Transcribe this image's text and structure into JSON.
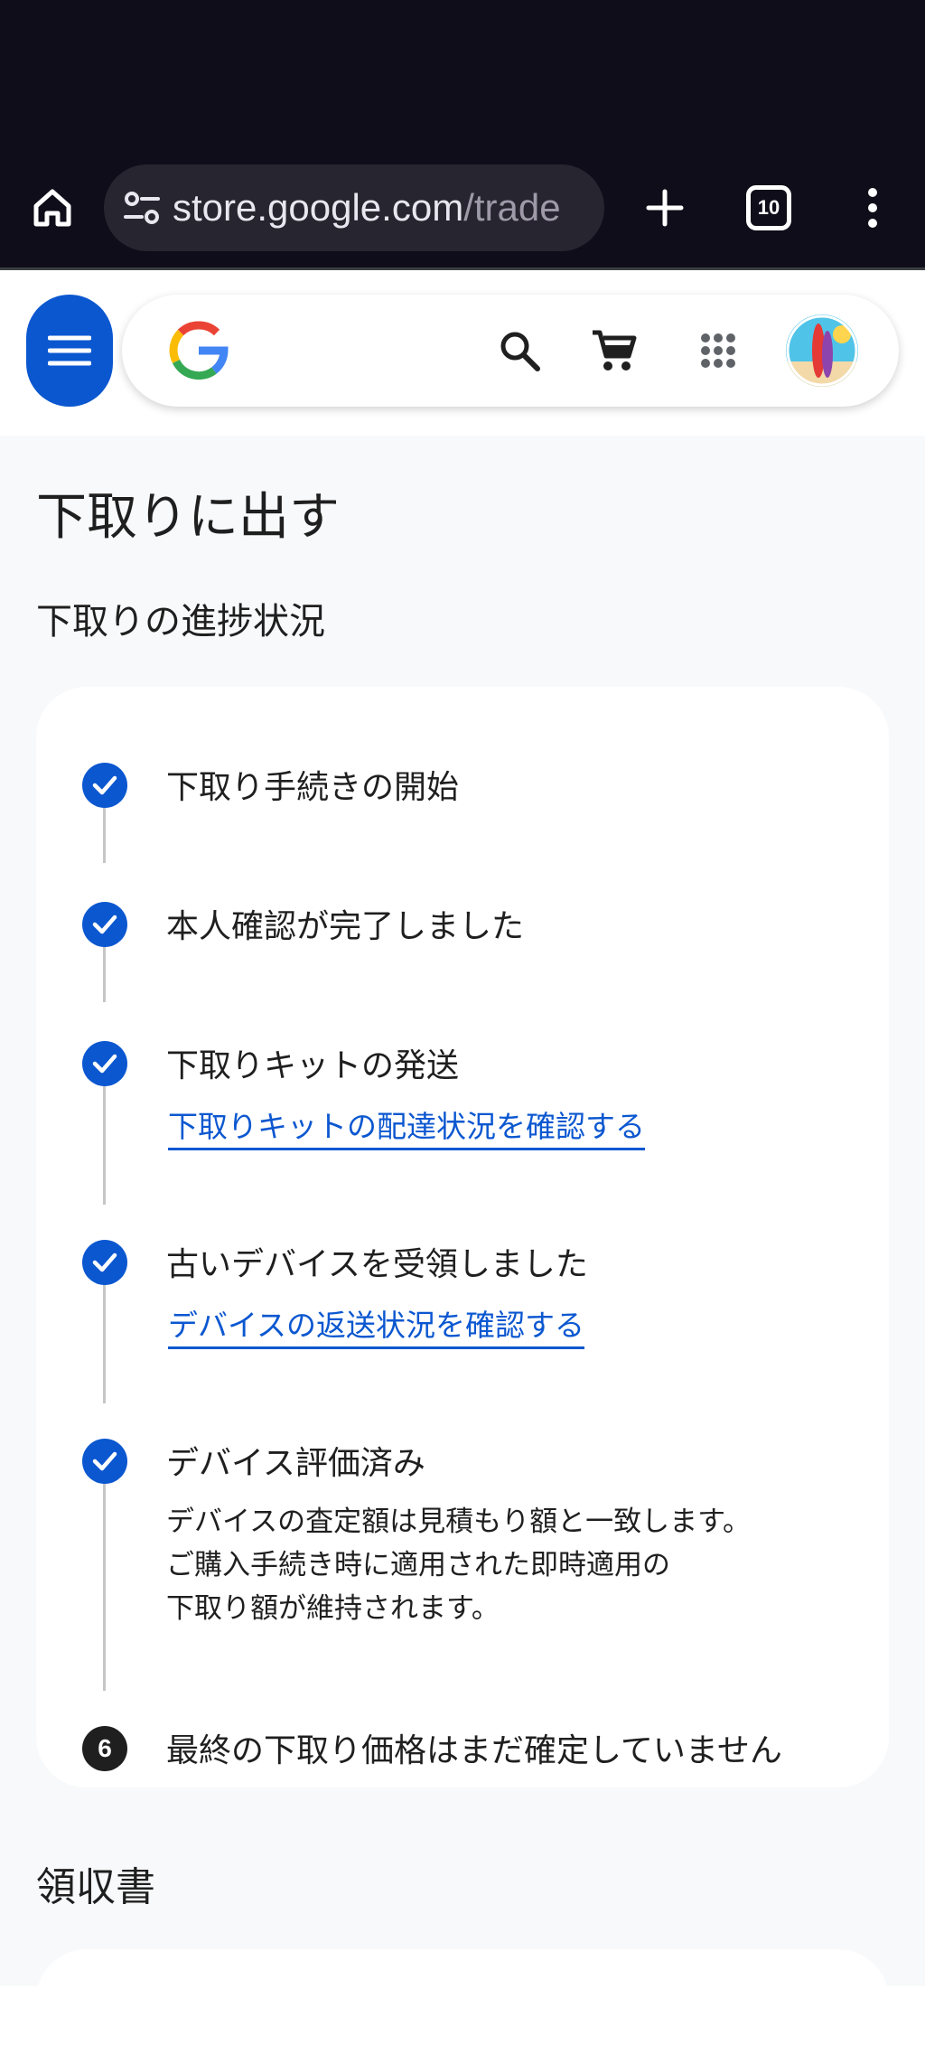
{
  "browser": {
    "url_host": "store.google.com",
    "url_path": "/trade",
    "tab_count": "10"
  },
  "header": {
    "menu_icon": "menu-icon",
    "logo": "google-g-logo",
    "icons": [
      "search-icon",
      "cart-icon",
      "apps-grid-icon",
      "avatar"
    ]
  },
  "page": {
    "title": "下取りに出す",
    "progress_heading": "下取りの進捗状況"
  },
  "steps": [
    {
      "label": "下取り手続きの開始",
      "status": "complete"
    },
    {
      "label": "本人確認が完了しました",
      "status": "complete"
    },
    {
      "label": "下取りキットの発送",
      "status": "complete",
      "link": "下取りキットの配達状況を確認する"
    },
    {
      "label": "古いデバイスを受領しました",
      "status": "complete",
      "link": "デバイスの返送状況を確認する"
    },
    {
      "label": "デバイス評価済み",
      "status": "complete",
      "desc": [
        "デバイスの査定額は見積もり額と一致します。",
        "ご購入手続き時に適用された即時適用の",
        "下取り額が維持されます。"
      ]
    },
    {
      "label": "最終の下取り価格はまだ確定していません",
      "status": "pending",
      "number": "6"
    }
  ],
  "receipt": {
    "heading": "領収書"
  },
  "colors": {
    "accent": "#0b57d0",
    "chrome_bg": "#0f0d19",
    "content_bg": "#f8f9fa"
  }
}
